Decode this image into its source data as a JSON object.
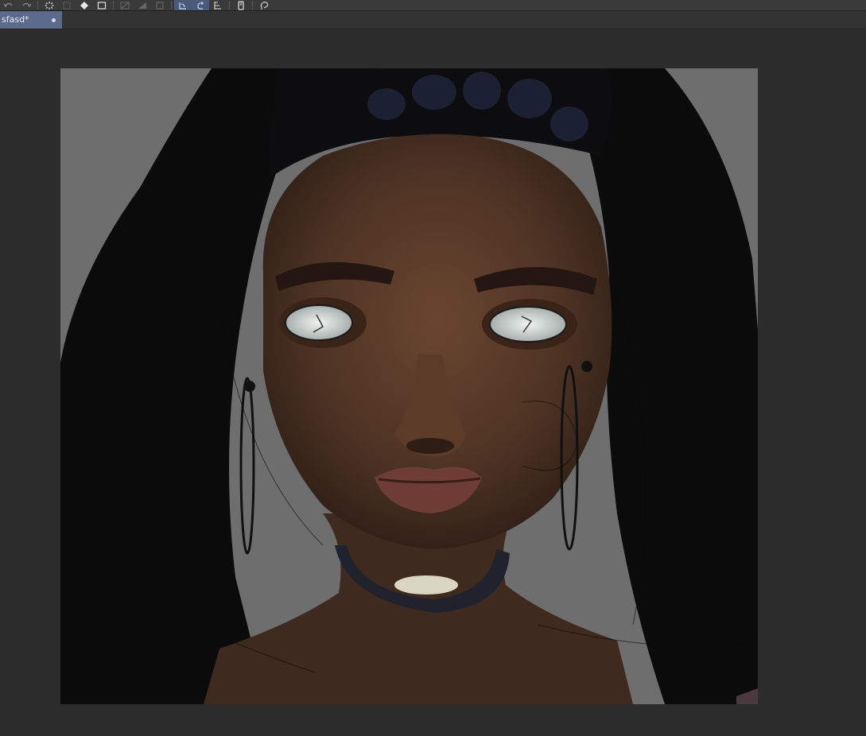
{
  "toolbar": {
    "items": [
      {
        "name": "undo-icon"
      },
      {
        "name": "redo-icon"
      },
      {
        "name": "loading-spinner-icon"
      },
      {
        "name": "clear-icon"
      },
      {
        "name": "fill-icon"
      },
      {
        "name": "transform-icon"
      },
      {
        "name": "select-all-icon"
      },
      {
        "name": "invert-selection-icon"
      },
      {
        "name": "crop-icon"
      },
      {
        "name": "rotate-left-icon"
      },
      {
        "name": "rotate-right-icon"
      },
      {
        "name": "flip-icon"
      },
      {
        "name": "device-icon"
      },
      {
        "name": "reference-icon"
      }
    ]
  },
  "document": {
    "tab_title": "sfasd*"
  },
  "colors": {
    "toolbar_bg": "#3a3a3a",
    "tab_active": "#5c6b8c",
    "workspace_bg": "#2c2c2c",
    "canvas_bg": "#6e6e6e",
    "skin_base": "#4a3223",
    "hair": "#0b0b0b"
  }
}
